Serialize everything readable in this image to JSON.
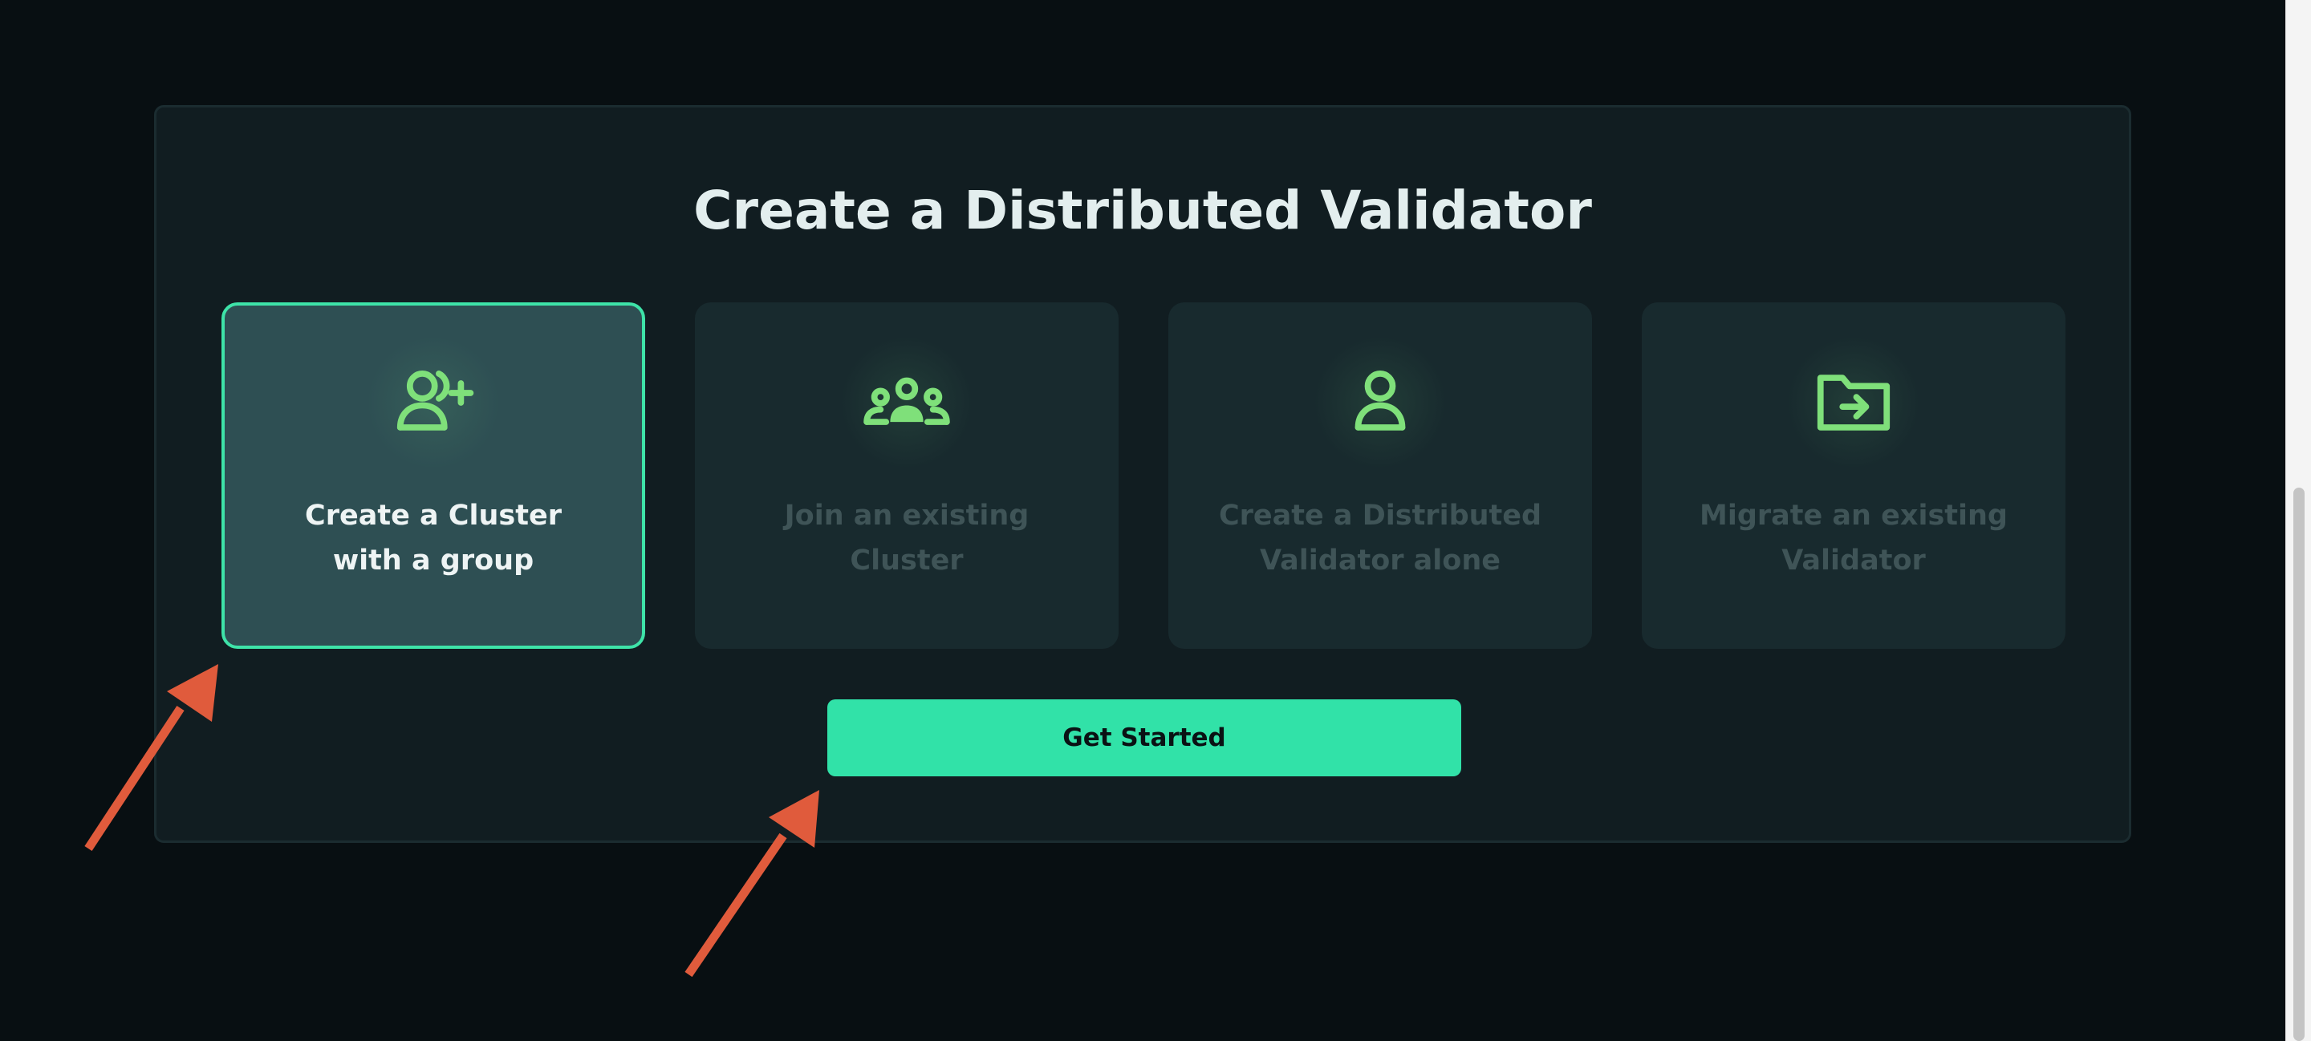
{
  "page": {
    "title": "Create a Distributed Validator"
  },
  "options": [
    {
      "id": "create-cluster-group",
      "line1": "Create a Cluster",
      "line2": "with a group",
      "icon": "user-add-icon",
      "selected": true
    },
    {
      "id": "join-cluster",
      "line1": "Join an existing",
      "line2": "Cluster",
      "icon": "group-icon",
      "selected": false
    },
    {
      "id": "create-alone",
      "line1": "Create a Distributed",
      "line2": "Validator alone",
      "icon": "user-icon",
      "selected": false
    },
    {
      "id": "migrate-validator",
      "line1": "Migrate an existing",
      "line2": "Validator",
      "icon": "folder-import-icon",
      "selected": false
    }
  ],
  "actions": {
    "get_started_label": "Get Started"
  },
  "colors": {
    "background": "#080f12",
    "panel": "#111d21",
    "card": "#182a2e",
    "card_selected": "#2e4f53",
    "accent": "#31e2a8",
    "icon_green": "#7fe07a",
    "annotation_arrow": "#e05b3c"
  }
}
